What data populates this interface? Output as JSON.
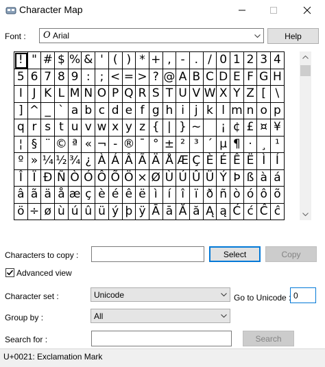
{
  "window": {
    "title": "Character Map"
  },
  "font": {
    "label": "Font :",
    "value": "Arial",
    "help_label": "Help"
  },
  "characters": [
    "!",
    "\"",
    "#",
    "$",
    "%",
    "&",
    "'",
    "(",
    ")",
    "*",
    "+",
    ",",
    "-",
    ".",
    "/",
    "0",
    "1",
    "2",
    "3",
    "4",
    "5",
    "6",
    "7",
    "8",
    "9",
    ":",
    ";",
    "<",
    "=",
    ">",
    "?",
    "@",
    "A",
    "B",
    "C",
    "D",
    "E",
    "F",
    "G",
    "H",
    "I",
    "J",
    "K",
    "L",
    "M",
    "N",
    "O",
    "P",
    "Q",
    "R",
    "S",
    "T",
    "U",
    "V",
    "W",
    "X",
    "Y",
    "Z",
    "[",
    "\\",
    "]",
    "^",
    "_",
    "`",
    "a",
    "b",
    "c",
    "d",
    "e",
    "f",
    "g",
    "h",
    "i",
    "j",
    "k",
    "l",
    "m",
    "n",
    "o",
    "p",
    "q",
    "r",
    "s",
    "t",
    "u",
    "v",
    "w",
    "x",
    "y",
    "z",
    "{",
    "|",
    "}",
    "~",
    " ",
    "¡",
    "¢",
    "£",
    "¤",
    "¥",
    "¦",
    "§",
    "¨",
    "©",
    "ª",
    "«",
    "¬",
    "-",
    "®",
    "¯",
    "°",
    "±",
    "²",
    "³",
    "´",
    "µ",
    "¶",
    "·",
    "¸",
    "¹",
    "º",
    "»",
    "¼",
    "½",
    "¾",
    "¿",
    "À",
    "Á",
    "Â",
    "Ã",
    "Ä",
    "Å",
    "Æ",
    "Ç",
    "È",
    "É",
    "Ê",
    "Ë",
    "Ì",
    "Í",
    "Î",
    "Ï",
    "Ð",
    "Ñ",
    "Ò",
    "Ó",
    "Ô",
    "Õ",
    "Ö",
    "×",
    "Ø",
    "Ù",
    "Ú",
    "Û",
    "Ü",
    "Ý",
    "Þ",
    "ß",
    "à",
    "á",
    "â",
    "ã",
    "ä",
    "å",
    "æ",
    "ç",
    "è",
    "é",
    "ê",
    "ë",
    "ì",
    "í",
    "î",
    "ï",
    "ð",
    "ñ",
    "ò",
    "ó",
    "ô",
    "õ",
    "ö",
    "÷",
    "ø",
    "ù",
    "ú",
    "û",
    "ü",
    "ý",
    "þ",
    "ÿ",
    "Ā",
    "ā",
    "Ă",
    "ă",
    "Ą",
    "ą",
    "Ć",
    "ć",
    "Ĉ",
    "ĉ"
  ],
  "selected_index": 0,
  "copy": {
    "label": "Characters to copy :",
    "value": "",
    "select_label": "Select",
    "copy_label": "Copy"
  },
  "advanced_view": {
    "label": "Advanced view",
    "checked": true
  },
  "character_set": {
    "label": "Character set :",
    "value": "Unicode"
  },
  "goto_unicode": {
    "label": "Go to Unicode :",
    "value": "0"
  },
  "group_by": {
    "label": "Group by :",
    "value": "All"
  },
  "search": {
    "label": "Search for :",
    "value": "",
    "button_label": "Search"
  },
  "status": {
    "text": "U+0021: Exclamation Mark"
  },
  "colors": {
    "focus_blue": "#0078d7",
    "status_bg": "#f0f0f0",
    "button_bg": "#e1e1e1"
  }
}
